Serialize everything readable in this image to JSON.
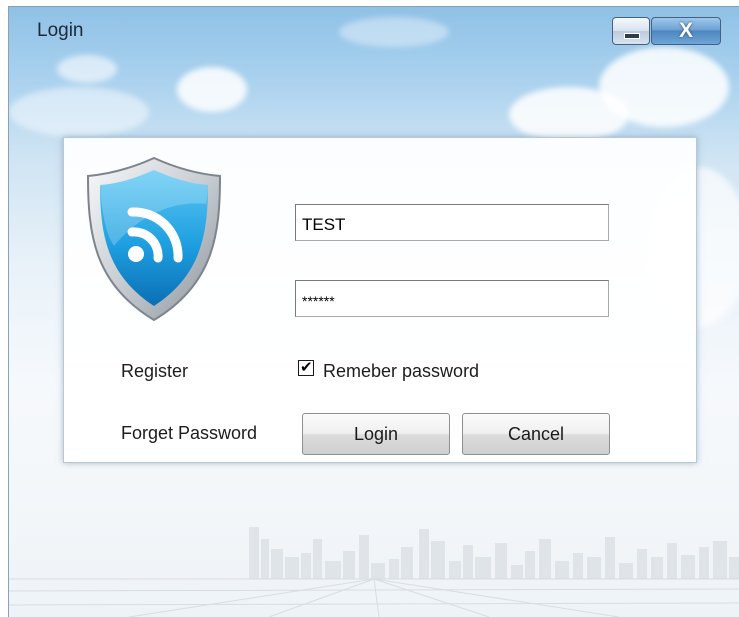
{
  "window": {
    "title": "Login",
    "close_glyph": "X"
  },
  "form": {
    "username_value": "TEST",
    "password_display": "******",
    "register_label": "Register",
    "remember_label": "Remeber password",
    "remember_checked": true,
    "forget_label": "Forget Password",
    "login_label": "Login",
    "cancel_label": "Cancel"
  },
  "icons": {
    "logo": "shield-wifi-icon",
    "minimize": "minimize-icon",
    "close": "close-icon",
    "check": "checkmark-icon"
  },
  "colors": {
    "shield_blue": "#1e9fe0",
    "shield_rim": "#e6e9ec",
    "close_button": "#5f96cc"
  }
}
